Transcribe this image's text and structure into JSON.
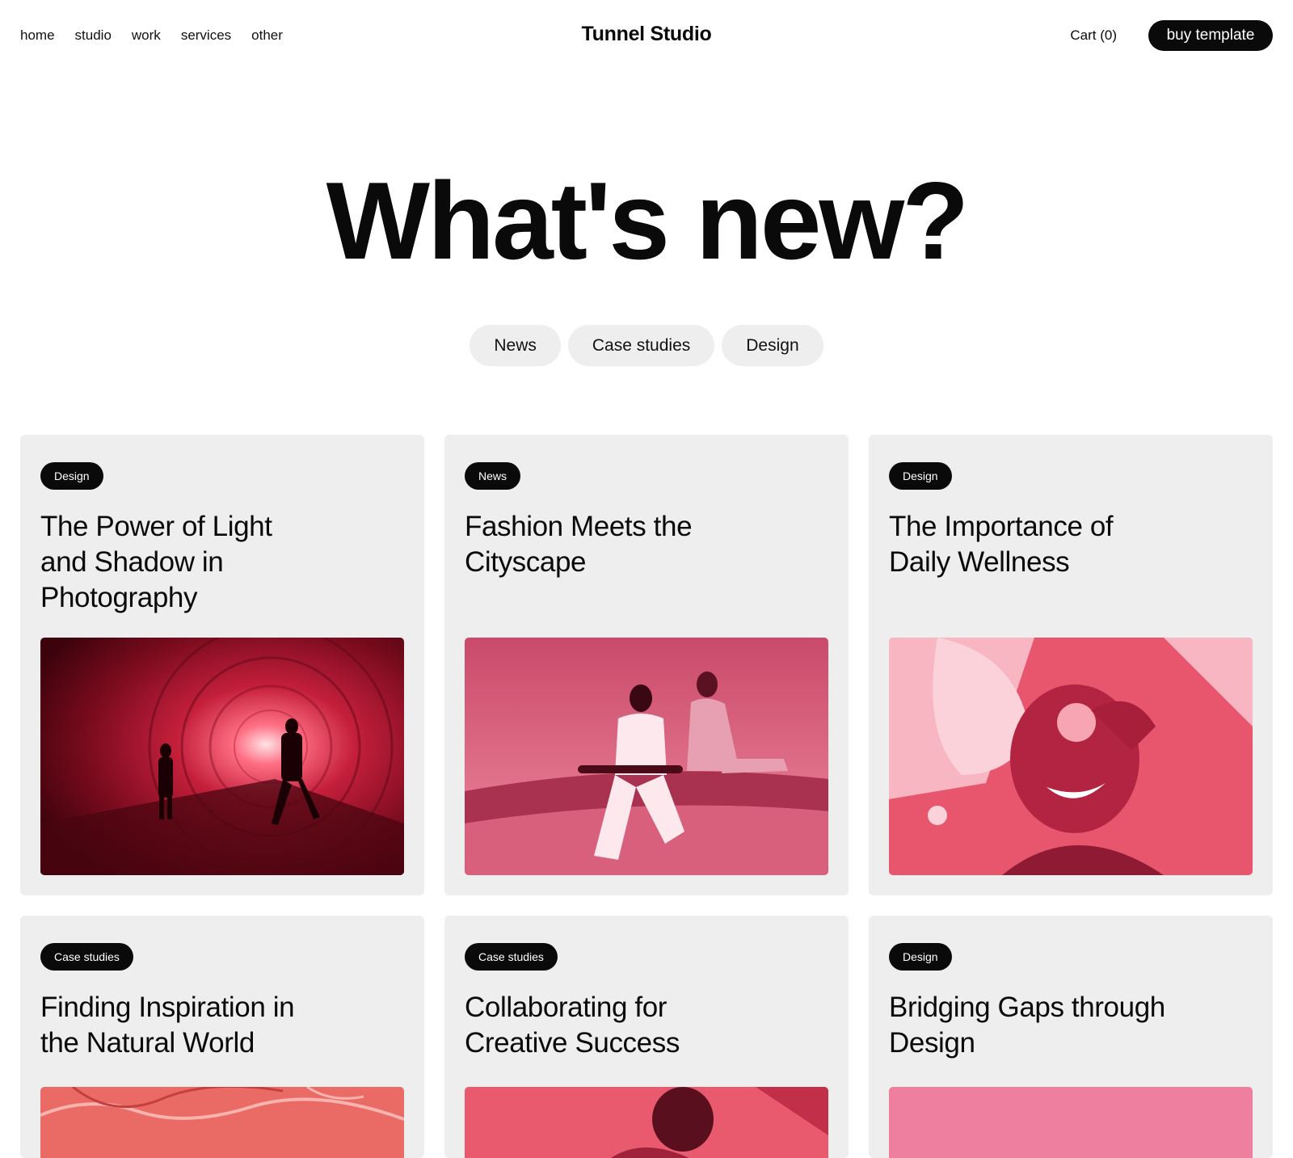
{
  "header": {
    "nav": [
      "home",
      "studio",
      "work",
      "services",
      "other"
    ],
    "brand": "Tunnel Studio",
    "cart": "Cart  (0)",
    "buy_label": "buy template"
  },
  "hero": {
    "title": "What's new?"
  },
  "filters": [
    "News",
    "Case studies",
    "Design"
  ],
  "posts": [
    {
      "tag": "Design",
      "title": "The Power of Light and Shadow in Photography",
      "image": "tunnel-silhouettes-image"
    },
    {
      "tag": "News",
      "title": "Fashion Meets the Cityscape",
      "image": "skateboard-fashion-image"
    },
    {
      "tag": "Design",
      "title": "The Importance of Daily Wellness",
      "image": "wellness-spa-image"
    },
    {
      "tag": "Case studies",
      "title": "Finding Inspiration in the Natural World",
      "image": "aerial-landscape-image"
    },
    {
      "tag": "Case studies",
      "title": "Collaborating for Creative Success",
      "image": "portrait-image"
    },
    {
      "tag": "Design",
      "title": "Bridging Gaps through Design",
      "image": "pink-abstract-image"
    }
  ],
  "colors": {
    "accent": "#d9324f",
    "card_bg": "#eeeeee",
    "chip_bg": "#eeeeee",
    "dark": "#0a0a0a"
  }
}
